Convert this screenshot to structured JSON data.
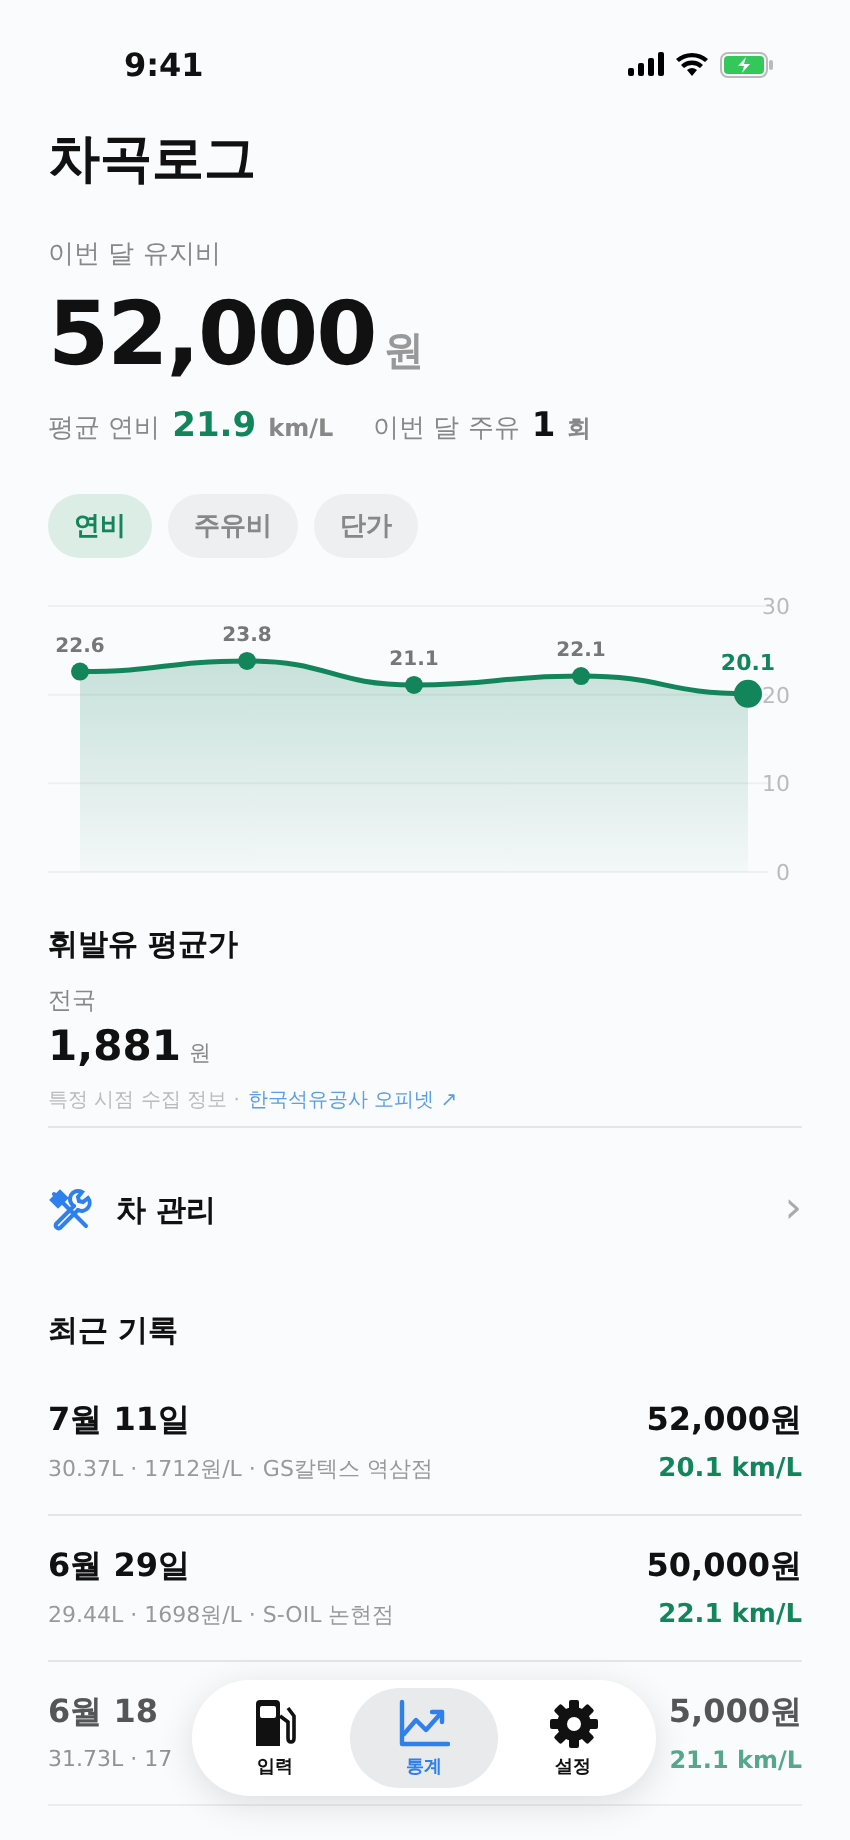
{
  "status_bar": {
    "time": "9:41"
  },
  "app_title": "차곡로그",
  "summary": {
    "label": "이번 달 유지비",
    "amount": "52,000",
    "unit": "원",
    "avg_label": "평균 연비",
    "avg_value": "21.9",
    "avg_unit": "km/L",
    "count_label": "이번 달 주유",
    "count_value": "1",
    "count_unit": "회"
  },
  "chart_tabs": [
    {
      "label": "연비",
      "selected": true
    },
    {
      "label": "주유비",
      "selected": false
    },
    {
      "label": "단가",
      "selected": false
    }
  ],
  "chart_data": {
    "type": "area",
    "series": [
      {
        "color": "#13855a",
        "values": [
          22.6,
          23.8,
          21.1,
          22.1,
          20.1
        ]
      }
    ],
    "ylim": [
      0,
      30
    ],
    "yticks": [
      0,
      10,
      20,
      30
    ],
    "data_labels": true
  },
  "fuel_price": {
    "title": "휘발유 평균가",
    "region": "전국",
    "price": "1,881",
    "unit": "원",
    "note": "특정 시점 수집 정보 ·",
    "link": "한국석유공사 오피넷 ↗"
  },
  "car_care": {
    "label": "차 관리",
    "chevron": "›"
  },
  "recent": {
    "title": "최근 기록",
    "rows": [
      {
        "date": "7월 11일",
        "detail": "30.37L · 1712원/L · GS칼텍스 역삼점",
        "amount": "52,000원",
        "efficiency": "20.1 km/L"
      },
      {
        "date": "6월 29일",
        "detail": "29.44L · 1698원/L · S-OIL 논현점",
        "amount": "50,000원",
        "efficiency": "22.1 km/L"
      },
      {
        "date": "6월 18",
        "detail": "31.73L · 17",
        "amount": "5,000원",
        "efficiency": "21.1 km/L"
      }
    ]
  },
  "tab_bar": [
    {
      "label": "입력",
      "kind": "fuel",
      "selected": false
    },
    {
      "label": "통계",
      "kind": "chart",
      "selected": true
    },
    {
      "label": "설정",
      "kind": "gear",
      "selected": false
    }
  ]
}
